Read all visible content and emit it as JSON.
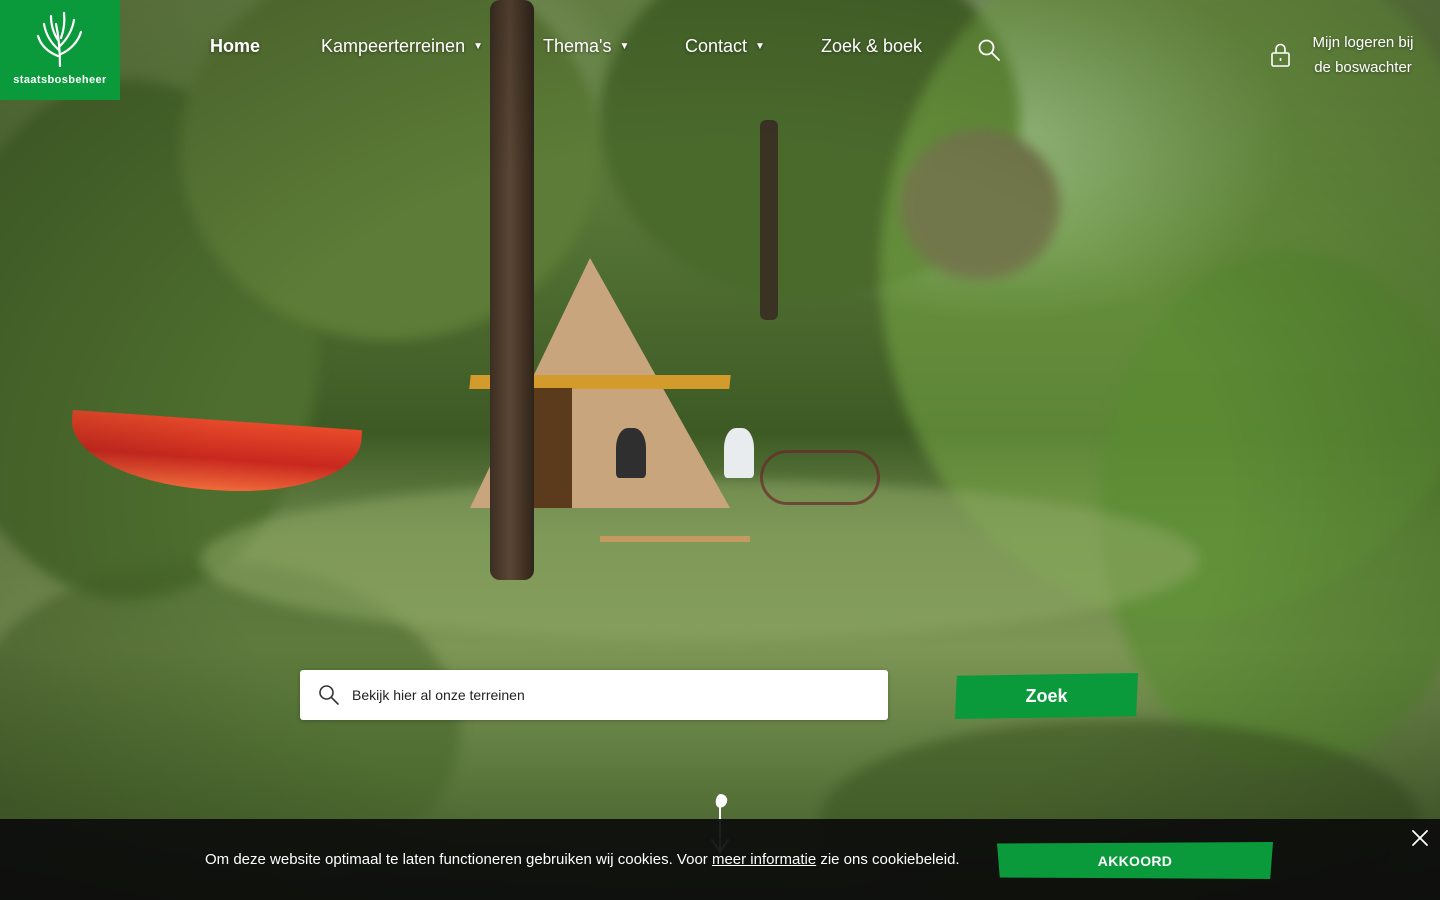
{
  "brand": {
    "name": "staatsbosbeheer",
    "accent": "#0a9a3c"
  },
  "nav": {
    "items": [
      {
        "label": "Home",
        "active": true,
        "dropdown": false
      },
      {
        "label": "Kampeerterreinen",
        "active": false,
        "dropdown": true
      },
      {
        "label": "Thema's",
        "active": false,
        "dropdown": true
      },
      {
        "label": "Contact",
        "active": false,
        "dropdown": true
      },
      {
        "label": "Zoek & boek",
        "active": false,
        "dropdown": false
      }
    ],
    "search_icon": "search-icon",
    "login_icon": "lock-icon",
    "login_line1": "Mijn logeren bij",
    "login_line2": "de boswachter"
  },
  "search": {
    "placeholder": "Bekijk hier al onze terreinen",
    "button_label": "Zoek",
    "icon": "search-icon"
  },
  "scroll": {
    "icon": "scroll-down-arrow-icon"
  },
  "cookie": {
    "text_before": "Om deze website optimaal te laten functioneren gebruiken wij cookies. Voor ",
    "link_text": "meer informatie",
    "text_after": " zie ons cookiebeleid.",
    "button_label": "AKKOORD",
    "close_icon": "close-icon",
    "background": "#0c0c0c"
  }
}
